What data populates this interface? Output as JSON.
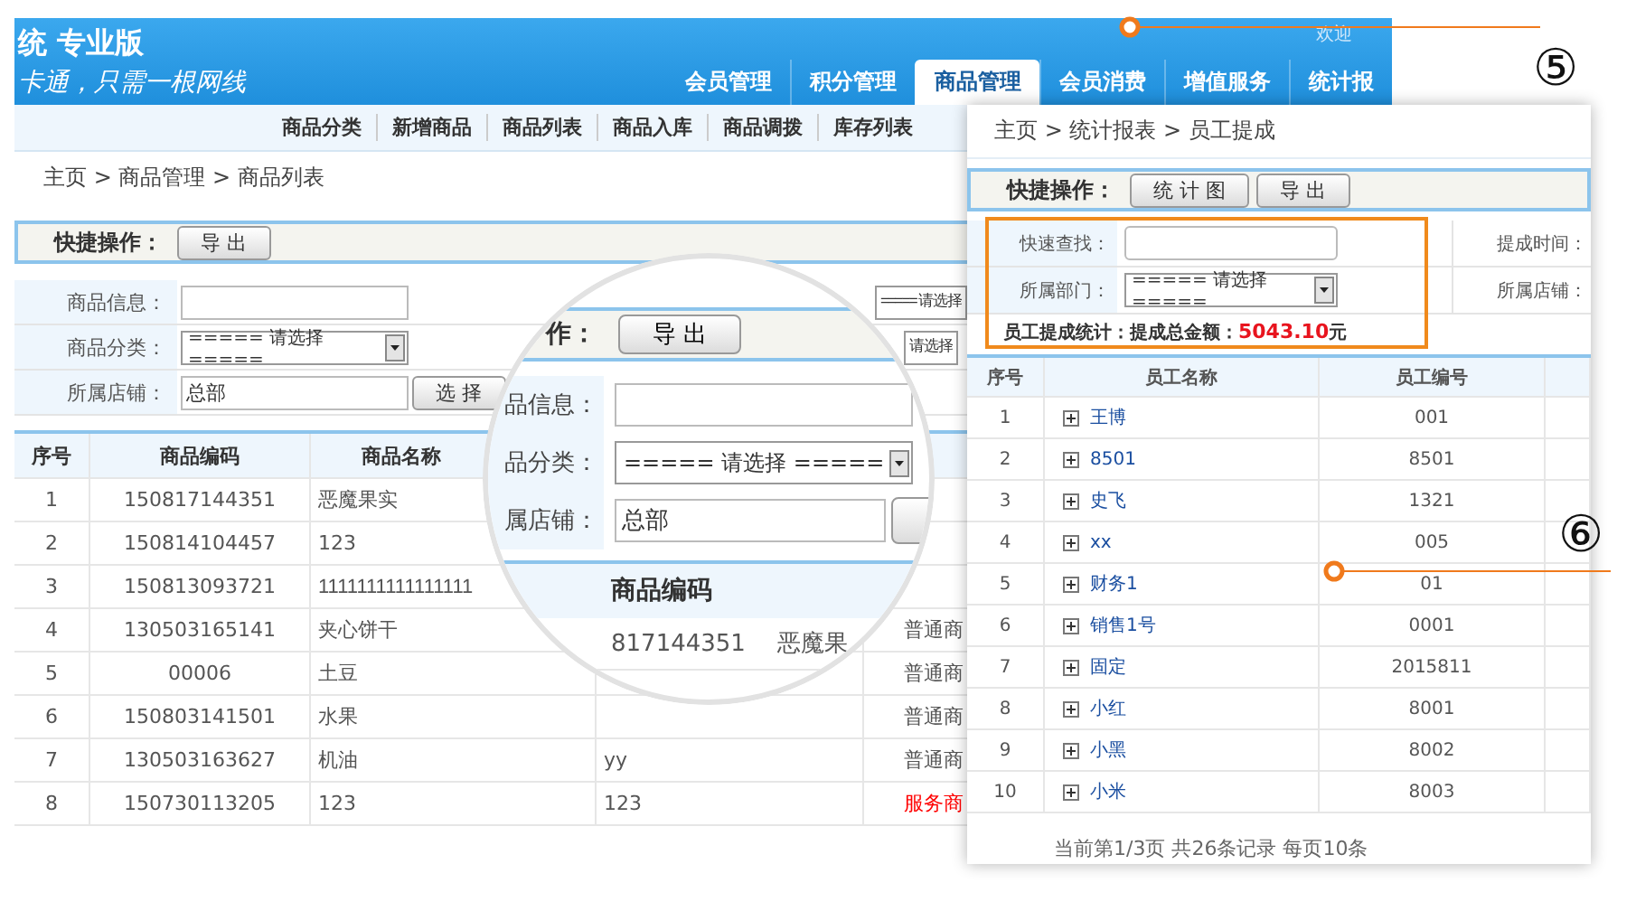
{
  "header": {
    "title": "统 专业版",
    "slogan": "卡通，只需一根网线",
    "welcome": "欢迎",
    "nav": [
      {
        "label": "会员管理",
        "selected": false
      },
      {
        "label": "积分管理",
        "selected": false
      },
      {
        "label": "商品管理",
        "selected": true
      },
      {
        "label": "会员消费",
        "selected": false
      },
      {
        "label": "增值服务",
        "selected": false
      },
      {
        "label": "统计报",
        "selected": false
      }
    ]
  },
  "subnav": [
    "商品分类",
    "新增商品",
    "商品列表",
    "商品入库",
    "商品调拨",
    "库存列表"
  ],
  "breadcrumb": "主页 > 商品管理 > 商品列表",
  "quick_actions": {
    "label": "快捷操作：",
    "buttons": [
      "导 出"
    ]
  },
  "filters": [
    {
      "label": "商品信息：",
      "kind": "input",
      "side_select": "===== 请选择"
    },
    {
      "label": "商品分类：",
      "kind": "select",
      "value": "===== 请选择 =====",
      "side_select": "请选择"
    },
    {
      "label": "所属店铺：",
      "kind": "picker",
      "value": "总部",
      "button": "选 择"
    }
  ],
  "table": {
    "columns": [
      "序号",
      "商品编码",
      "商品名称"
    ],
    "rows": [
      {
        "no": "1",
        "code": "150817144351",
        "name": "恶魔果实"
      },
      {
        "no": "2",
        "code": "150814104457",
        "name": "123"
      },
      {
        "no": "3",
        "code": "150813093721",
        "name": "1111111111111111"
      },
      {
        "no": "4",
        "code": "130503165141",
        "name": "夹心饼干",
        "column_5": {
          "text": "普通商",
          "color": "#555555"
        }
      },
      {
        "no": "5",
        "code": "00006",
        "name": "土豆",
        "column_5": {
          "text": "普通商",
          "color": "#555555"
        }
      },
      {
        "no": "6",
        "code": "150803141501",
        "name": "水果",
        "column_5": {
          "text": "普通商",
          "color": "#555555"
        }
      },
      {
        "no": "7",
        "code": "130503163627",
        "name": "机油",
        "column_4": "yy",
        "column_5": {
          "text": "普通商",
          "color": "#555555"
        }
      },
      {
        "no": "8",
        "code": "150730113205",
        "name": "123",
        "column_4": "123",
        "column_5": {
          "text": "服务商",
          "color": "#ff0000"
        }
      }
    ]
  },
  "magnifier": {
    "action_label": "作：",
    "button": "导 出",
    "filters": [
      {
        "label": "品信息：",
        "kind": "input"
      },
      {
        "label": "品分类：",
        "kind": "select",
        "value": "===== 请选择 ====="
      },
      {
        "label": "属店铺：",
        "kind": "picker",
        "value": "总部"
      }
    ],
    "column": "商品编码",
    "code": "817144351",
    "name": "恶魔果"
  },
  "report_panel": {
    "breadcrumb": "主页 > 统计报表 > 员工提成",
    "quick_actions": {
      "label": "快捷操作：",
      "buttons": [
        "统 计 图",
        "导 出"
      ]
    },
    "filters": [
      {
        "label": "快速查找：",
        "kind": "input",
        "side_label": "提成时间："
      },
      {
        "label": "所属部门：",
        "kind": "select",
        "value": "===== 请选择 =====",
        "side_label": "所属店铺："
      }
    ],
    "summary": {
      "label": "员工提成统计：提成总金额：",
      "amount": "5043.10",
      "unit": "元"
    },
    "table": {
      "columns": [
        "序号",
        "员工名称",
        "员工编号"
      ],
      "rows": [
        {
          "no": "1",
          "name": "王博",
          "code": "001"
        },
        {
          "no": "2",
          "name": "8501",
          "code": "8501"
        },
        {
          "no": "3",
          "name": "史飞",
          "code": "1321"
        },
        {
          "no": "4",
          "name": "xx",
          "code": "005"
        },
        {
          "no": "5",
          "name": "财务1",
          "code": "01"
        },
        {
          "no": "6",
          "name": "销售1号",
          "code": "0001"
        },
        {
          "no": "7",
          "name": "固定",
          "code": "2015811"
        },
        {
          "no": "8",
          "name": "小红",
          "code": "8001"
        },
        {
          "no": "9",
          "name": "小黑",
          "code": "8002"
        },
        {
          "no": "10",
          "name": "小米",
          "code": "8003"
        }
      ]
    },
    "pagination": "当前第1/3页 共26条记录 每页10条"
  },
  "callouts": [
    {
      "label": "⑤"
    },
    {
      "label": "⑥"
    }
  ]
}
